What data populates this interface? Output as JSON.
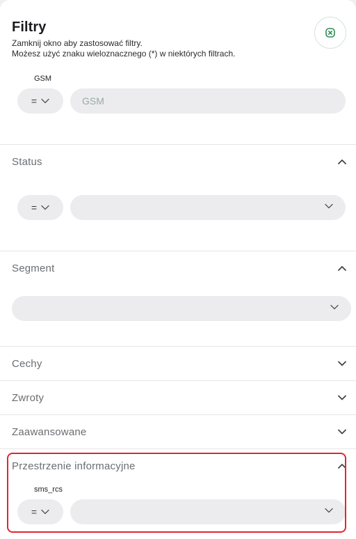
{
  "header": {
    "title": "Filtry",
    "subtitle_line1": "Zamknij okno aby zastosować filtry.",
    "subtitle_line2": "Możesz użyć znaku wieloznacznego (*) w niektórych filtrach."
  },
  "gsm": {
    "label": "GSM",
    "operator": "=",
    "placeholder": "GSM",
    "value": ""
  },
  "sections": {
    "status": {
      "title": "Status",
      "expanded": true,
      "operator": "="
    },
    "segment": {
      "title": "Segment",
      "expanded": true
    },
    "cechy": {
      "title": "Cechy",
      "expanded": false
    },
    "zwroty": {
      "title": "Zwroty",
      "expanded": false
    },
    "zaawansowane": {
      "title": "Zaawansowane",
      "expanded": false
    },
    "przestrzenie": {
      "title": "Przestrzenie informacyjne",
      "expanded": true,
      "field_label": "sms_rcs",
      "operator": "="
    }
  },
  "colors": {
    "accent": "#2e8b57",
    "field_bg": "#ececef",
    "highlight": "#e0262f"
  },
  "icons": {
    "close": "close-circle-icon",
    "expand": "chevron-down-icon",
    "collapse": "chevron-up-icon"
  }
}
